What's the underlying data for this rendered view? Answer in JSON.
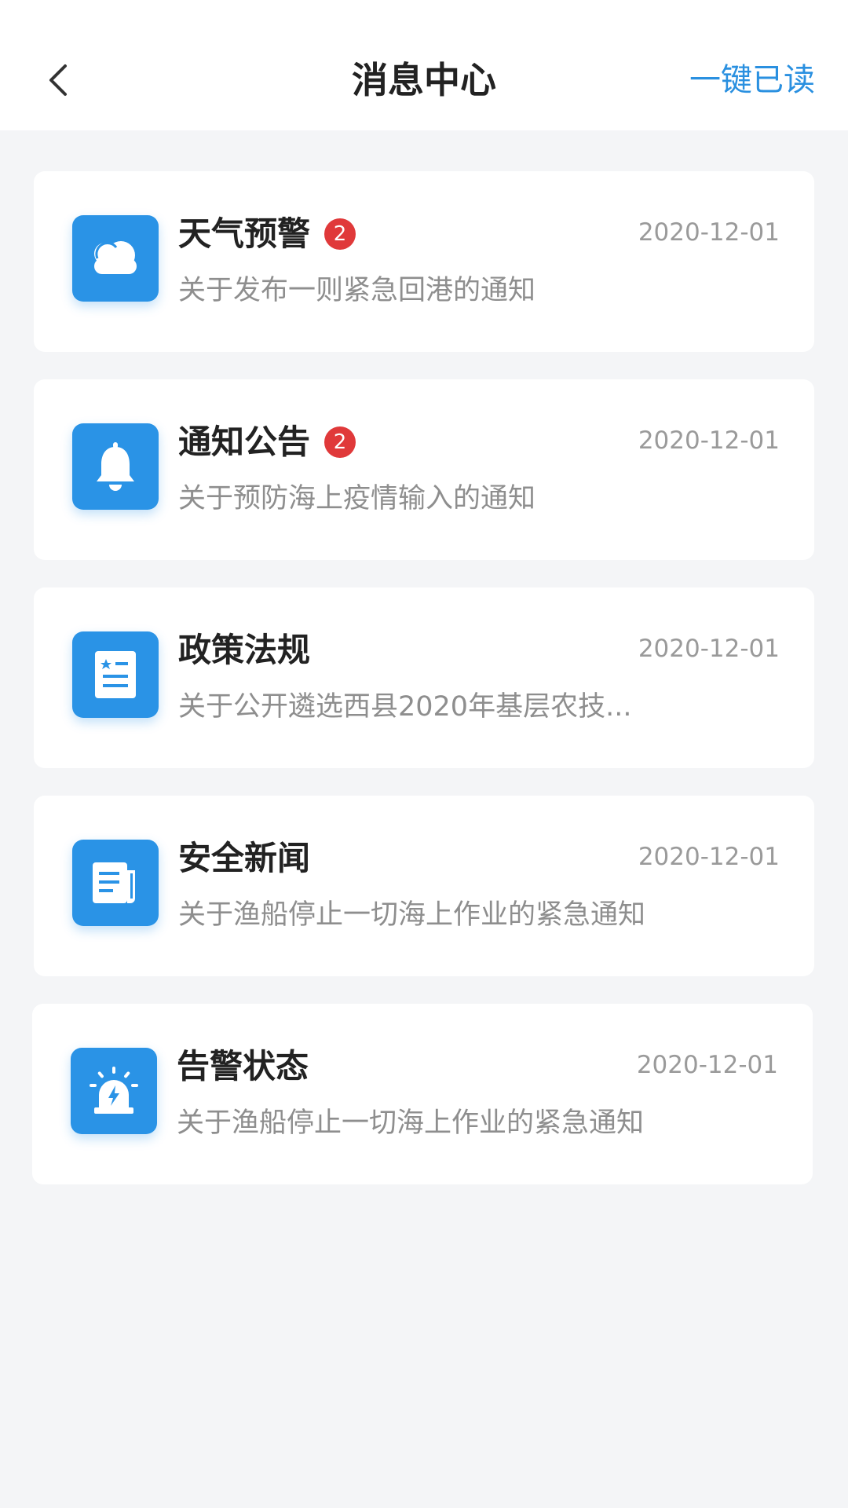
{
  "header": {
    "title": "消息中心",
    "action_label": "一键已读"
  },
  "colors": {
    "accent": "#2a90e0",
    "icon_tile": "#2a93e6",
    "badge": "#e0393a",
    "background": "#f4f5f7"
  },
  "messages": [
    {
      "icon": "cloud-icon",
      "title": "天气预警",
      "badge": "2",
      "date": "2020-12-01",
      "summary": "关于发布一则紧急回港的通知"
    },
    {
      "icon": "bell-icon",
      "title": "通知公告",
      "badge": "2",
      "date": "2020-12-01",
      "summary": "关于预防海上疫情输入的通知"
    },
    {
      "icon": "document-icon",
      "title": "政策法规",
      "badge": "",
      "date": "2020-12-01",
      "summary": "关于公开遴选西县2020年基层农技..."
    },
    {
      "icon": "newspaper-icon",
      "title": "安全新闻",
      "badge": "",
      "date": "2020-12-01",
      "summary": "关于渔船停止一切海上作业的紧急通知"
    },
    {
      "icon": "alarm-light-icon",
      "title": "告警状态",
      "badge": "",
      "date": "2020-12-01",
      "summary": "关于渔船停止一切海上作业的紧急通知"
    }
  ]
}
